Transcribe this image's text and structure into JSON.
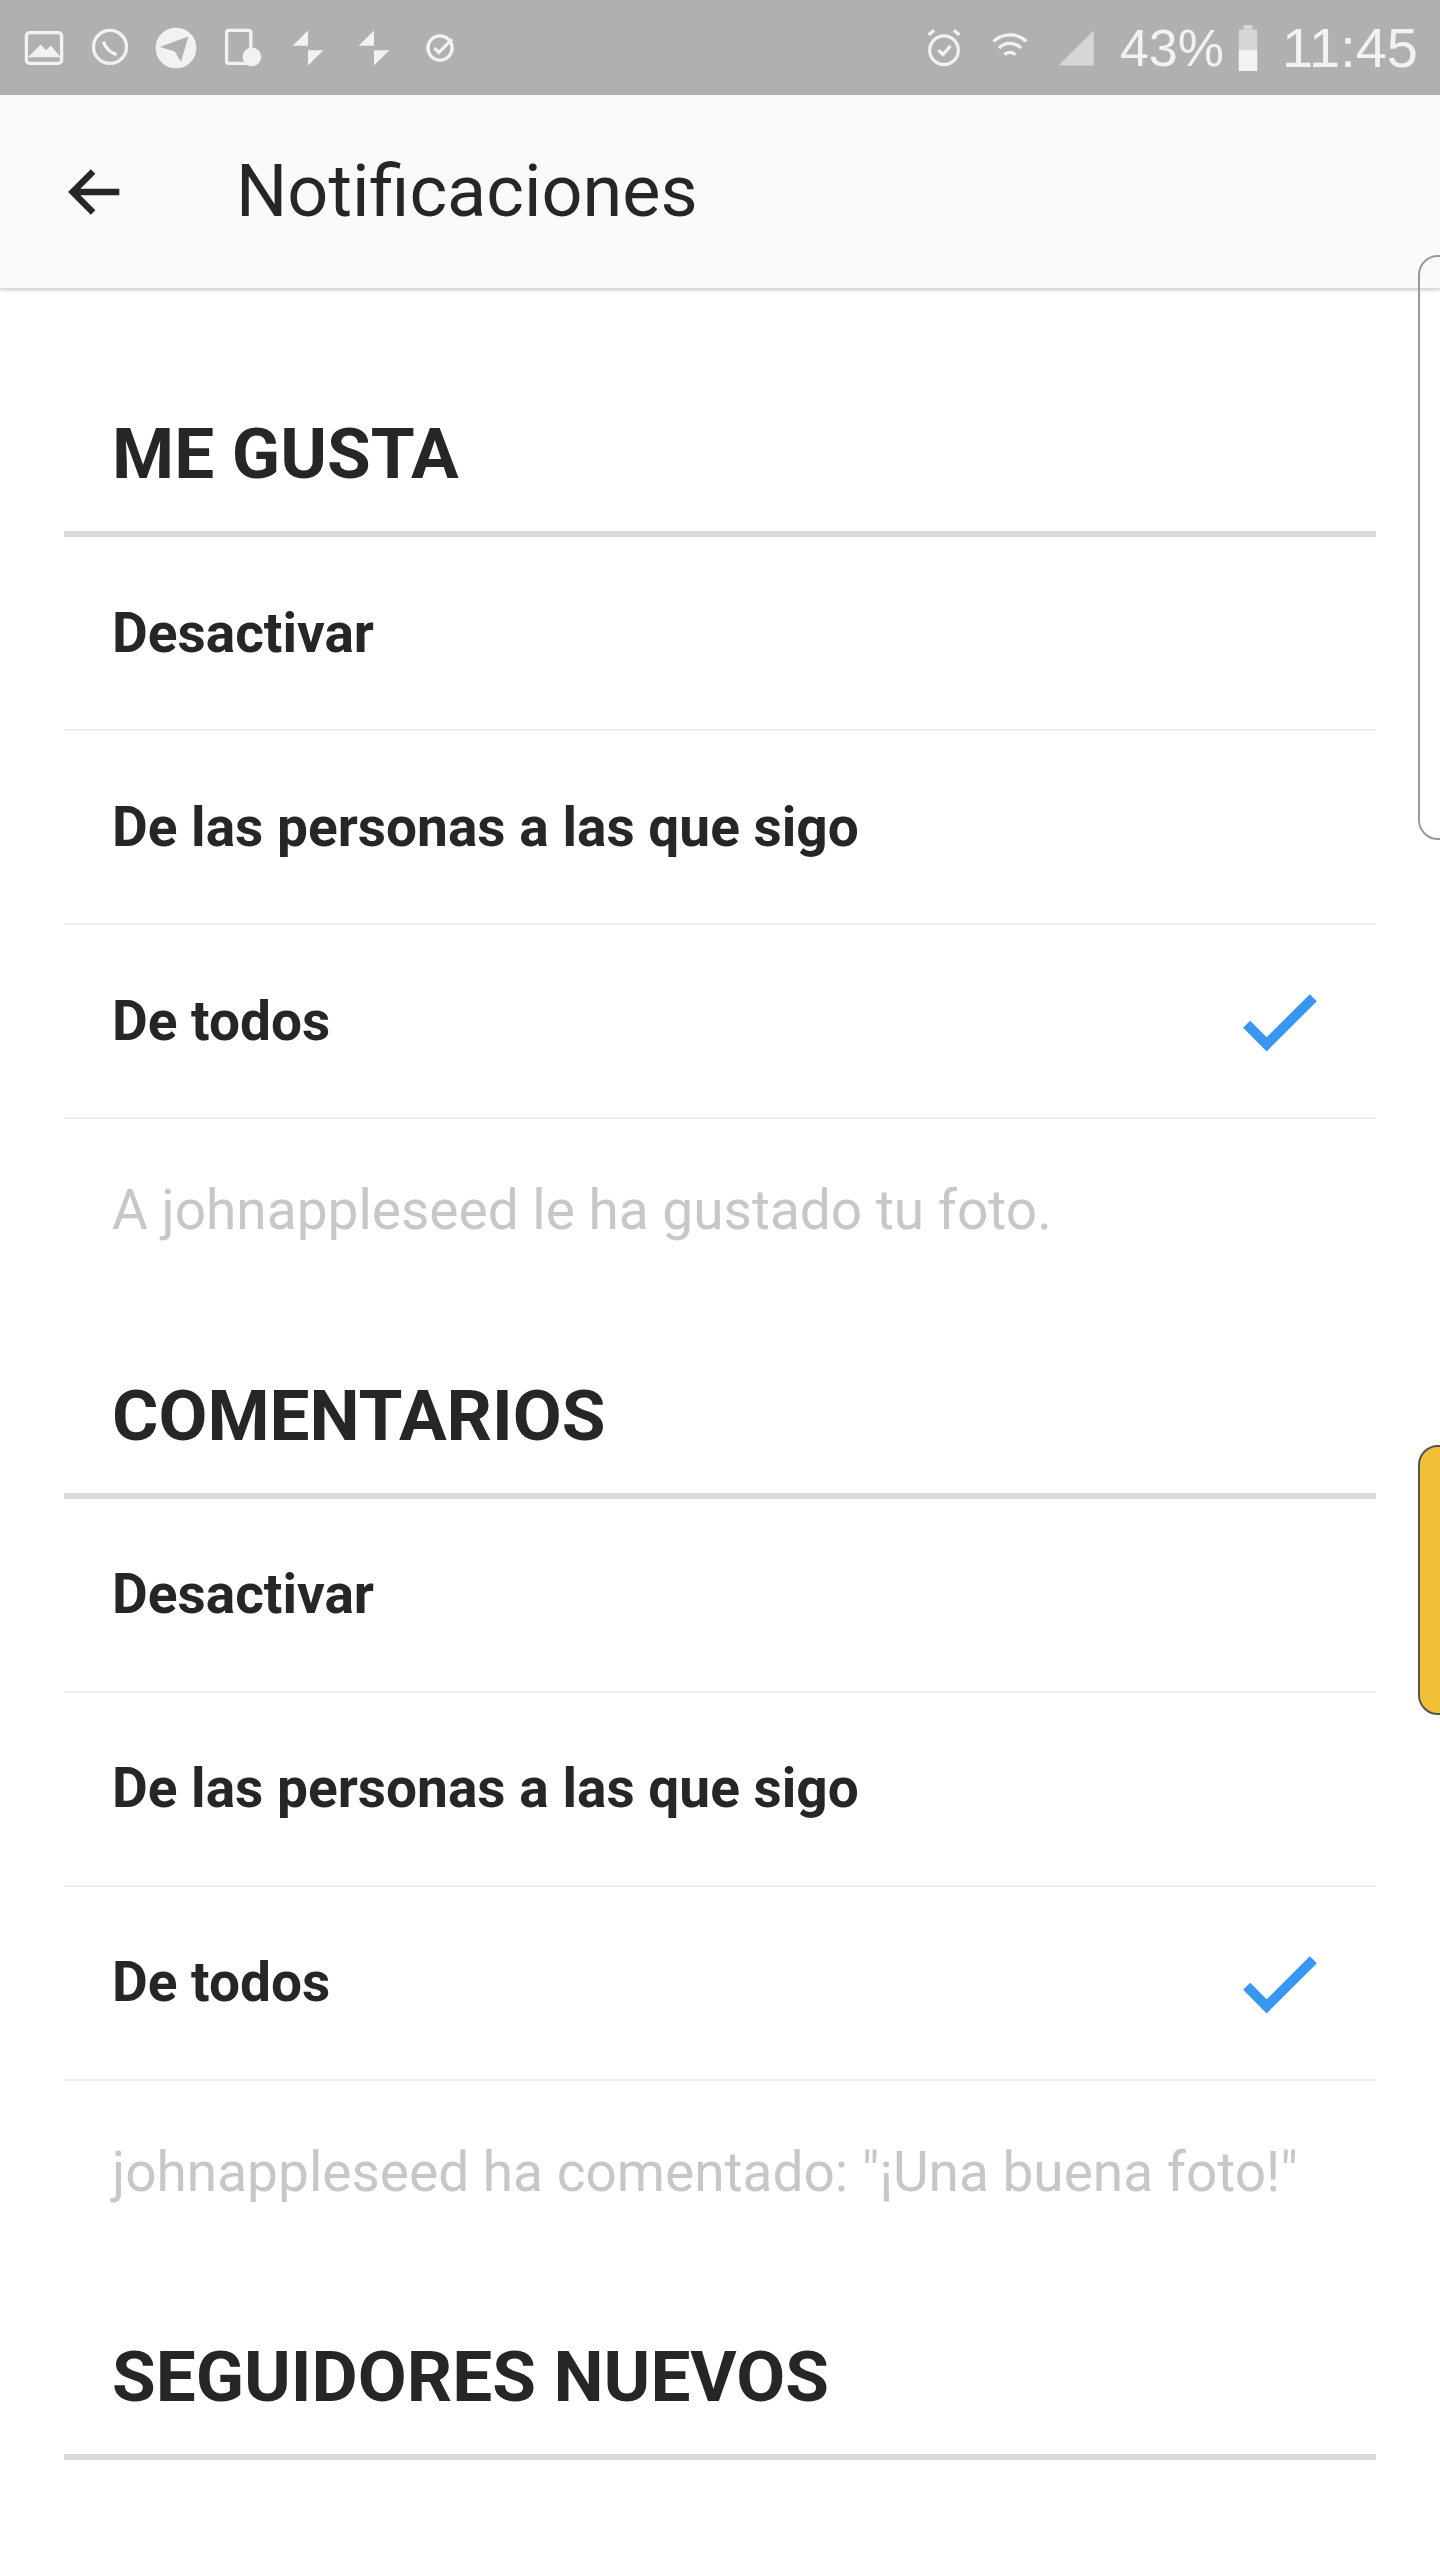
{
  "status_bar": {
    "battery": "43%",
    "time": "11:45"
  },
  "app_bar": {
    "title": "Notificaciones"
  },
  "sections": [
    {
      "title": "ME GUSTA",
      "options": [
        {
          "label": "Desactivar",
          "selected": false
        },
        {
          "label": "De las personas a las que sigo",
          "selected": false
        },
        {
          "label": "De todos",
          "selected": true
        }
      ],
      "preview": "A johnappleseed le ha gustado tu foto."
    },
    {
      "title": "COMENTARIOS",
      "options": [
        {
          "label": "Desactivar",
          "selected": false
        },
        {
          "label": "De las personas a las que sigo",
          "selected": false
        },
        {
          "label": "De todos",
          "selected": true
        }
      ],
      "preview": "johnappleseed ha comentado: \"¡Una buena foto!\""
    },
    {
      "title": "SEGUIDORES NUEVOS"
    }
  ]
}
